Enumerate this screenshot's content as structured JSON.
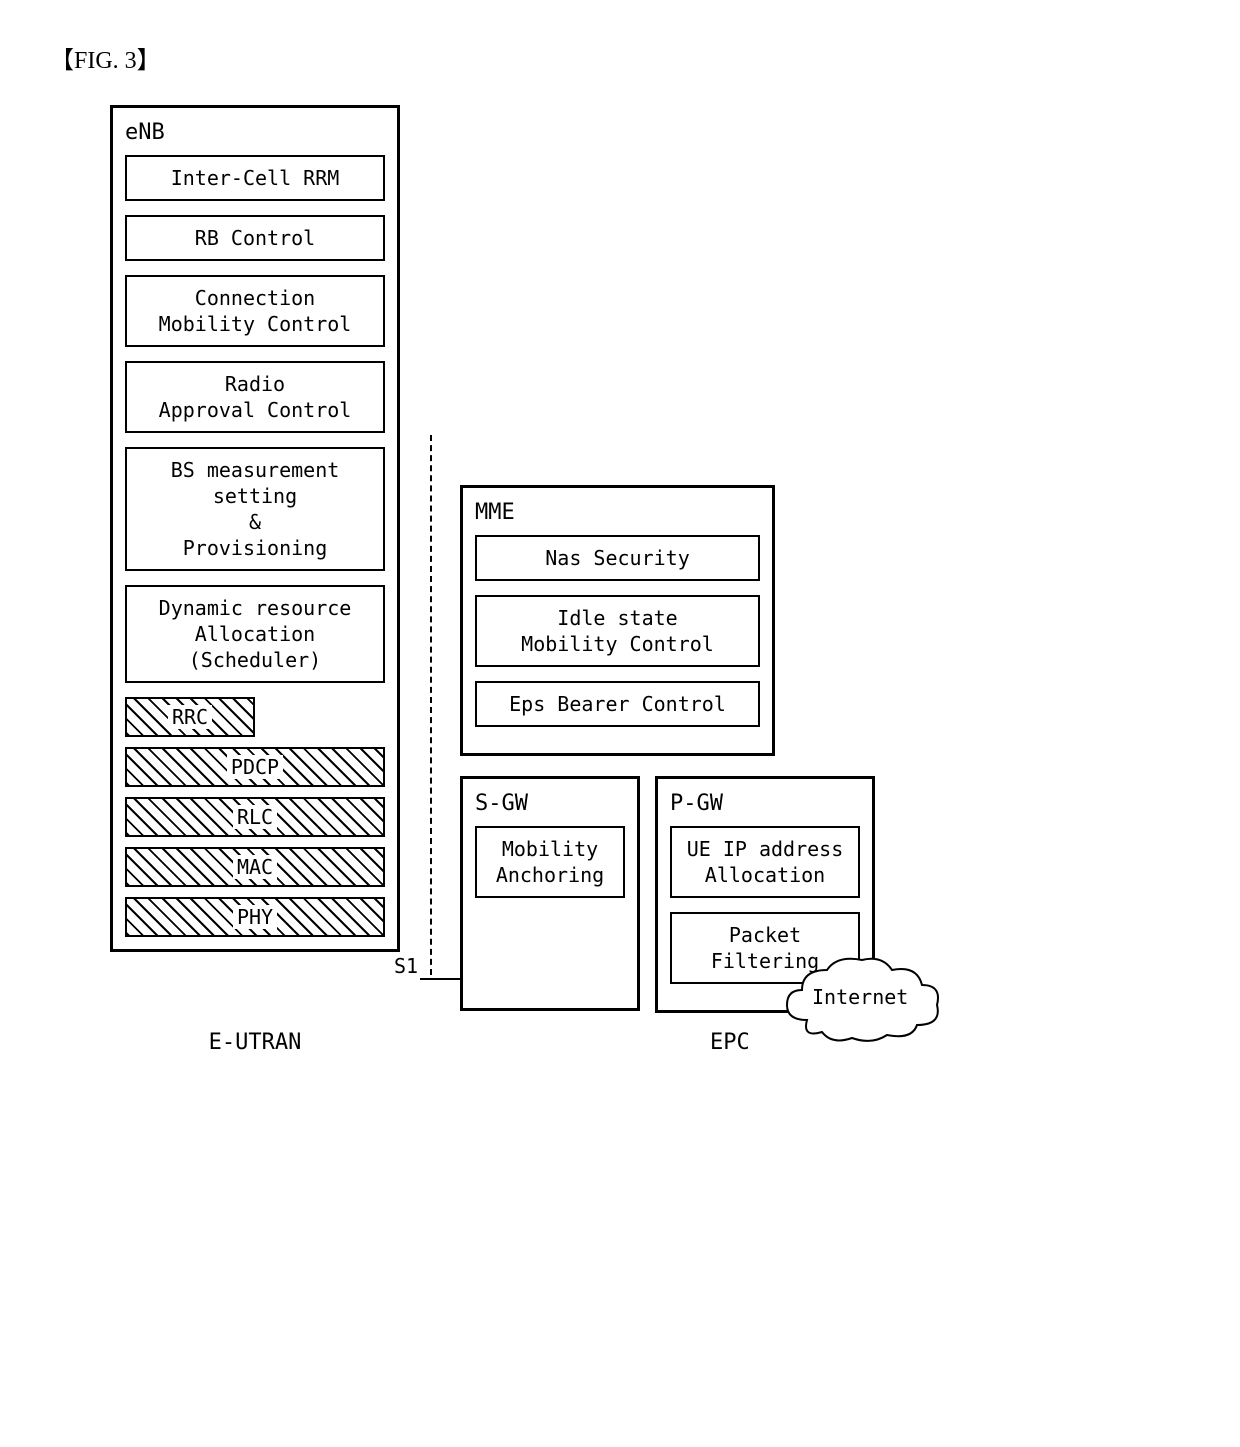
{
  "figure_label": "【FIG. 3】",
  "enb": {
    "title": "eNB",
    "blocks": {
      "inter_cell_rrm": "Inter-Cell RRM",
      "rb_control": "RB Control",
      "connection_mobility": "Connection\nMobility Control",
      "radio_approval": "Radio\nApproval Control",
      "bs_measurement": "BS measurement\nsetting\n&\nProvisioning",
      "dynamic_resource": "Dynamic resource\nAllocation\n(Scheduler)"
    },
    "layers": {
      "rrc": "RRC",
      "pdcp": "PDCP",
      "rlc": "RLC",
      "mac": "MAC",
      "phy": "PHY"
    }
  },
  "interface": {
    "s1": "S1"
  },
  "mme": {
    "title": "MME",
    "blocks": {
      "nas_security": "Nas Security",
      "idle_state": "Idle state\nMobility Control",
      "eps_bearer": "Eps Bearer Control"
    }
  },
  "sgw": {
    "title": "S-GW",
    "blocks": {
      "mobility_anchoring": "Mobility\nAnchoring"
    }
  },
  "pgw": {
    "title": "P-GW",
    "blocks": {
      "ue_ip": "UE IP address\nAllocation",
      "packet_filtering": "Packet\nFiltering"
    }
  },
  "labels": {
    "eutran": "E-UTRAN",
    "epc": "EPC",
    "internet": "Internet"
  }
}
